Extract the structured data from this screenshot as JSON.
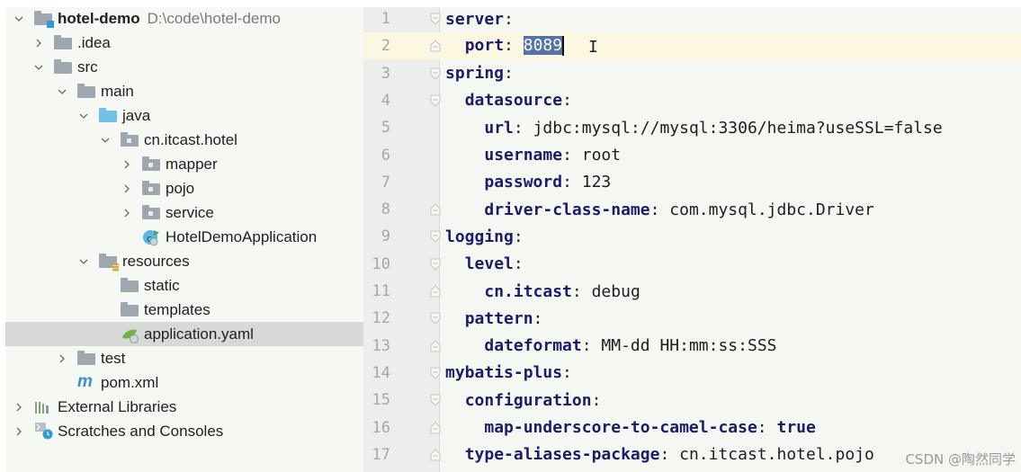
{
  "project_tree": {
    "items": [
      {
        "label": "hotel-demo",
        "path": "D:\\code\\hotel-demo",
        "expanded": true,
        "icon": "module-folder-icon"
      },
      {
        "label": ".idea",
        "expanded": false,
        "icon": "folder-icon"
      },
      {
        "label": "src",
        "expanded": true,
        "icon": "folder-icon"
      },
      {
        "label": "main",
        "expanded": true,
        "icon": "folder-icon"
      },
      {
        "label": "java",
        "expanded": true,
        "icon": "source-folder-icon"
      },
      {
        "label": "cn.itcast.hotel",
        "expanded": true,
        "icon": "package-icon"
      },
      {
        "label": "mapper",
        "expanded": false,
        "icon": "package-icon"
      },
      {
        "label": "pojo",
        "expanded": false,
        "icon": "package-icon"
      },
      {
        "label": "service",
        "expanded": false,
        "icon": "package-icon"
      },
      {
        "label": "HotelDemoApplication",
        "icon": "spring-boot-class-icon"
      },
      {
        "label": "resources",
        "expanded": true,
        "icon": "resources-folder-icon"
      },
      {
        "label": "static",
        "icon": "folder-icon"
      },
      {
        "label": "templates",
        "icon": "folder-icon"
      },
      {
        "label": "application.yaml",
        "icon": "spring-yaml-icon",
        "selected": true
      },
      {
        "label": "test",
        "expanded": false,
        "icon": "folder-icon"
      },
      {
        "label": "pom.xml",
        "icon": "maven-icon"
      },
      {
        "label": "External Libraries",
        "expanded": false,
        "icon": "libraries-icon"
      },
      {
        "label": "Scratches and Consoles",
        "expanded": false,
        "icon": "scratches-icon"
      }
    ]
  },
  "editor": {
    "current_line": 2,
    "selected_text": "8089",
    "lines": [
      {
        "n": "1",
        "key": "server",
        "sep": ":",
        "value": ""
      },
      {
        "n": "2",
        "indent": "  ",
        "key": "port",
        "sep": ": ",
        "value": "8089"
      },
      {
        "n": "3",
        "key": "spring",
        "sep": ":",
        "value": ""
      },
      {
        "n": "4",
        "indent": "  ",
        "key": "datasource",
        "sep": ":",
        "value": ""
      },
      {
        "n": "5",
        "indent": "    ",
        "key": "url",
        "sep": ": ",
        "value": "jdbc:mysql://mysql:3306/heima?useSSL=false"
      },
      {
        "n": "6",
        "indent": "    ",
        "key": "username",
        "sep": ": ",
        "value": "root"
      },
      {
        "n": "7",
        "indent": "    ",
        "key": "password",
        "sep": ": ",
        "value": "123"
      },
      {
        "n": "8",
        "indent": "    ",
        "key": "driver-class-name",
        "sep": ": ",
        "value": "com.mysql.jdbc.Driver"
      },
      {
        "n": "9",
        "key": "logging",
        "sep": ":",
        "value": ""
      },
      {
        "n": "10",
        "indent": "  ",
        "key": "level",
        "sep": ":",
        "value": ""
      },
      {
        "n": "11",
        "indent": "    ",
        "key": "cn.itcast",
        "sep": ": ",
        "value": "debug"
      },
      {
        "n": "12",
        "indent": "  ",
        "key": "pattern",
        "sep": ":",
        "value": ""
      },
      {
        "n": "13",
        "indent": "    ",
        "key": "dateformat",
        "sep": ": ",
        "value": "MM-dd HH:mm:ss:SSS"
      },
      {
        "n": "14",
        "key": "mybatis-plus",
        "sep": ":",
        "value": ""
      },
      {
        "n": "15",
        "indent": "  ",
        "key": "configuration",
        "sep": ":",
        "value": ""
      },
      {
        "n": "16",
        "indent": "    ",
        "key": "map-underscore-to-camel-case",
        "sep": ": ",
        "value": "true"
      },
      {
        "n": "17",
        "indent": "  ",
        "key": "type-aliases-package",
        "sep": ": ",
        "value": "cn.itcast.hotel.pojo"
      }
    ]
  },
  "watermark": "CSDN @陶然同学"
}
